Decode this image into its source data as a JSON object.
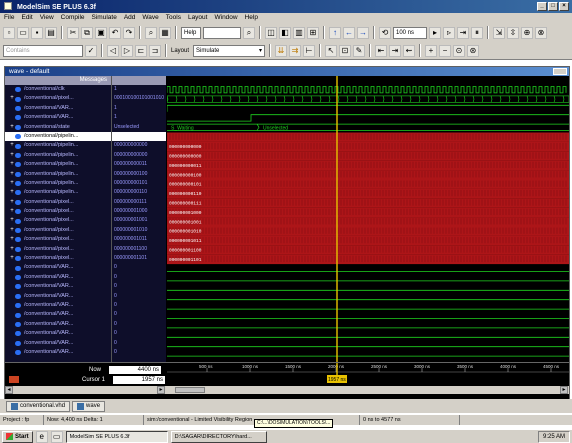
{
  "window": {
    "title": "ModelSim SE PLUS 6.3f"
  },
  "menu": [
    "File",
    "Edit",
    "View",
    "Compile",
    "Simulate",
    "Add",
    "Wave",
    "Tools",
    "Layout",
    "Window",
    "Help"
  ],
  "toolbar": {
    "help_field": "Help",
    "run_length": "100 ns",
    "layout_label": "Layout",
    "layout_value": "Simulate",
    "contains_placeholder": "Contains"
  },
  "wave_window": {
    "title": "wave - default",
    "messages_header": "Messages",
    "signals": [
      {
        "name": "/conventional/clk",
        "value": "1",
        "expand": false,
        "selected": false
      },
      {
        "name": "/conventional/pixel...",
        "value": "000100100101001010",
        "expand": true,
        "selected": false
      },
      {
        "name": "/conventional/VAR...",
        "value": "1",
        "expand": false,
        "selected": false
      },
      {
        "name": "/conventional/VAR...",
        "value": "1",
        "expand": false,
        "selected": false
      },
      {
        "name": "/conventional/state",
        "value": "Unselected",
        "expand": true,
        "selected": false
      },
      {
        "name": "/conventional/pipelin...",
        "value": "",
        "expand": true,
        "selected": true
      },
      {
        "name": "/conventional/pipelin...",
        "value": "000000000000",
        "expand": true,
        "selected": false
      },
      {
        "name": "/conventional/pipelin...",
        "value": "000000000000",
        "expand": true,
        "selected": false
      },
      {
        "name": "/conventional/pipelin...",
        "value": "000000000011",
        "expand": true,
        "selected": false
      },
      {
        "name": "/conventional/pipelin...",
        "value": "000000000100",
        "expand": true,
        "selected": false
      },
      {
        "name": "/conventional/pipelin...",
        "value": "000000000101",
        "expand": true,
        "selected": false
      },
      {
        "name": "/conventional/pipelin...",
        "value": "000000000110",
        "expand": true,
        "selected": false
      },
      {
        "name": "/conventional/pixel...",
        "value": "000000000111",
        "expand": true,
        "selected": false
      },
      {
        "name": "/conventional/pixel...",
        "value": "000000001000",
        "expand": true,
        "selected": false
      },
      {
        "name": "/conventional/pixel...",
        "value": "000000001001",
        "expand": true,
        "selected": false
      },
      {
        "name": "/conventional/pixel...",
        "value": "000000001010",
        "expand": true,
        "selected": false
      },
      {
        "name": "/conventional/pixel...",
        "value": "000000001011",
        "expand": true,
        "selected": false
      },
      {
        "name": "/conventional/pixel...",
        "value": "000000001100",
        "expand": true,
        "selected": false
      },
      {
        "name": "/conventional/pixel...",
        "value": "000000001101",
        "expand": true,
        "selected": false
      },
      {
        "name": "/conventional/VAR...",
        "value": "0",
        "expand": false,
        "selected": false
      },
      {
        "name": "/conventional/VAR...",
        "value": "0",
        "expand": false,
        "selected": false
      },
      {
        "name": "/conventional/VAR...",
        "value": "0",
        "expand": false,
        "selected": false
      },
      {
        "name": "/conventional/VAR...",
        "value": "0",
        "expand": false,
        "selected": false
      },
      {
        "name": "/conventional/VAR...",
        "value": "0",
        "expand": false,
        "selected": false
      },
      {
        "name": "/conventional/VAR...",
        "value": "0",
        "expand": false,
        "selected": false
      },
      {
        "name": "/conventional/VAR...",
        "value": "0",
        "expand": false,
        "selected": false
      },
      {
        "name": "/conventional/VAR...",
        "value": "0",
        "expand": false,
        "selected": false
      },
      {
        "name": "/conventional/VAR...",
        "value": "0",
        "expand": false,
        "selected": false
      },
      {
        "name": "/conventional/VAR...",
        "value": "0",
        "expand": false,
        "selected": false
      }
    ],
    "state_labels": [
      "S_Waiting",
      "Unselected"
    ],
    "now_label": "Now",
    "now_value": "4400 ns",
    "cursor_label": "Cursor 1",
    "cursor_value": "1957 ns",
    "cursor_marker": "1957 ns",
    "time_ticks": [
      "500 ns",
      "1000 ns",
      "1500 ns",
      "2000 ns",
      "2500 ns",
      "3000 ns",
      "3500 ns",
      "4000 ns",
      "4500 ns"
    ]
  },
  "tabs": [
    "conventional.vhd",
    "wave"
  ],
  "status": {
    "project": "Project : fp",
    "now": "Now: 4,400 ns  Delta: 1",
    "context": "sim:/conventional - Limited Visibility Region",
    "range": "0 ns to 4577 ns"
  },
  "tooltip": "C:\\...\\DOSIMULATION\\TOOLS\\...",
  "taskbar": {
    "start": "Start",
    "tasks": [
      "ModelSim SE PLUS 6.3f",
      "D:\\SAGAR\\DIRECTORY\\hard..."
    ],
    "clock": "9:25 AM"
  },
  "colors": {
    "wave_green": "#1fd41f",
    "bus_red": "#c0171b",
    "cursor_yellow": "#e8c200",
    "title_blue": "#0a246a"
  }
}
